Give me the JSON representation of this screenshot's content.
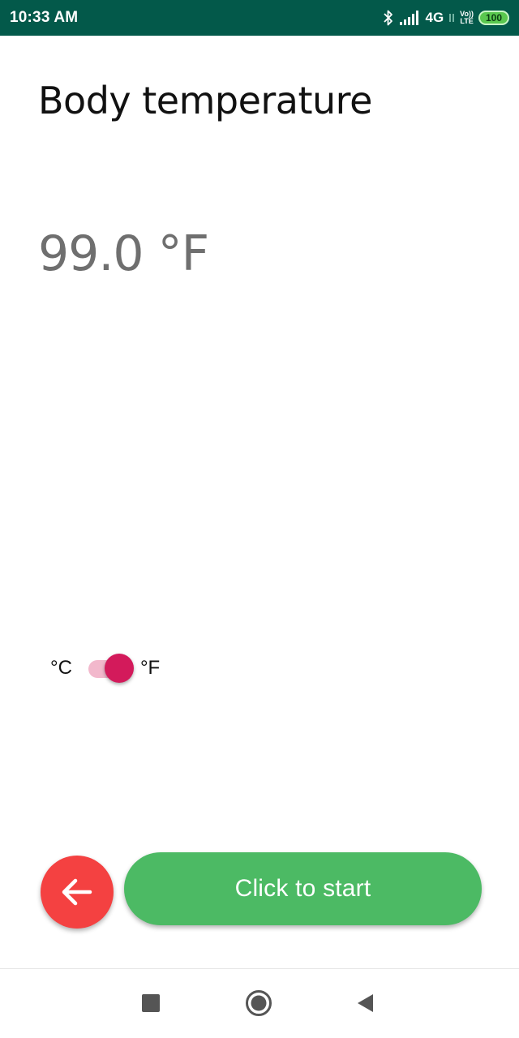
{
  "status_bar": {
    "time": "10:33 AM",
    "network": "4G",
    "lte_top": "Vo))",
    "lte_bottom": "LTE",
    "battery": "100"
  },
  "screen": {
    "title": "Body temperature",
    "value": "99.0 °F"
  },
  "unit_toggle": {
    "celsius_label": "°C",
    "fahrenheit_label": "°F",
    "selected": "°F"
  },
  "actions": {
    "start_label": "Click to start"
  },
  "colors": {
    "status_bar": "#03594a",
    "start_button": "#4cba64",
    "back_button": "#f44141",
    "switch_thumb": "#d31a5b",
    "switch_track": "#f2b8cc"
  },
  "icons": {
    "back": "arrow-left-icon",
    "nav_recents": "square-icon",
    "nav_home": "circle-icon",
    "nav_back": "triangle-back-icon"
  }
}
